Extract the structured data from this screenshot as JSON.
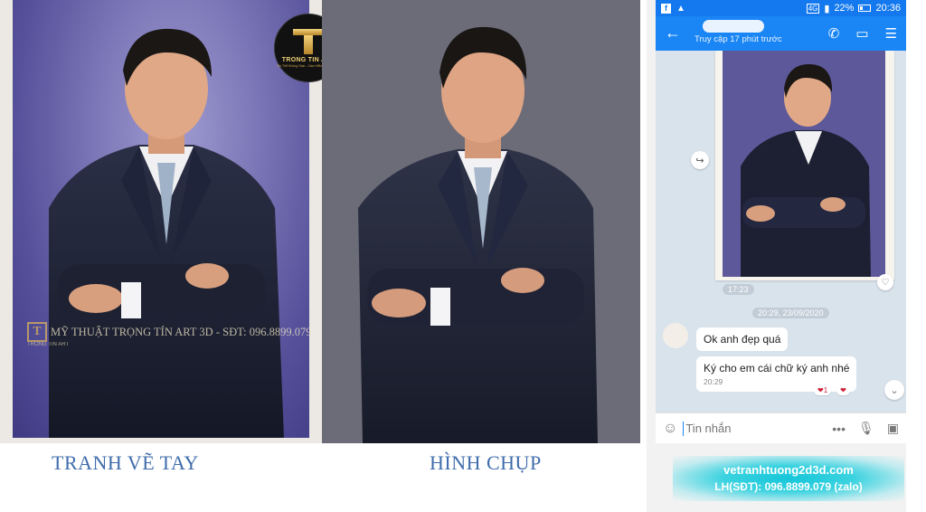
{
  "painting": {
    "caption": "TRANH VẼ TAY",
    "watermark_text": "MỸ THUẬT TRỌNG TÍN ART 3D  -  SĐT: 096.8899.079",
    "watermark_sub": "TRONG TIN ART",
    "logo_name": "TRONG TIN ART",
    "logo_sub": "Đồ Thể Không Gian - Cảm Hiểu Nghệ Thuật"
  },
  "photo": {
    "caption": "HÌNH CHỤP"
  },
  "phone": {
    "status": {
      "network": "4G",
      "battery": "22%",
      "time": "20:36"
    },
    "header": {
      "last_seen": "Truy cập 17 phút trước"
    },
    "chat": {
      "image_time": "17:23",
      "date_separator": "20:29, 23/09/2020",
      "messages": [
        {
          "text": "Ok anh đẹp quá"
        },
        {
          "text": "Ký cho em cái chữ ký anh nhé",
          "time": "20:29"
        }
      ],
      "reaction_count": "1"
    },
    "composer": {
      "placeholder": "Tin nhắn"
    }
  },
  "promo": {
    "website": "vetranhtuong2d3d.com",
    "contact": "LH(SĐT): 096.8899.079 (zalo)"
  },
  "colors": {
    "zalo_blue": "#1a86f5",
    "caption_blue": "#3f6cab",
    "promo_cyan": "#15c6d9"
  }
}
